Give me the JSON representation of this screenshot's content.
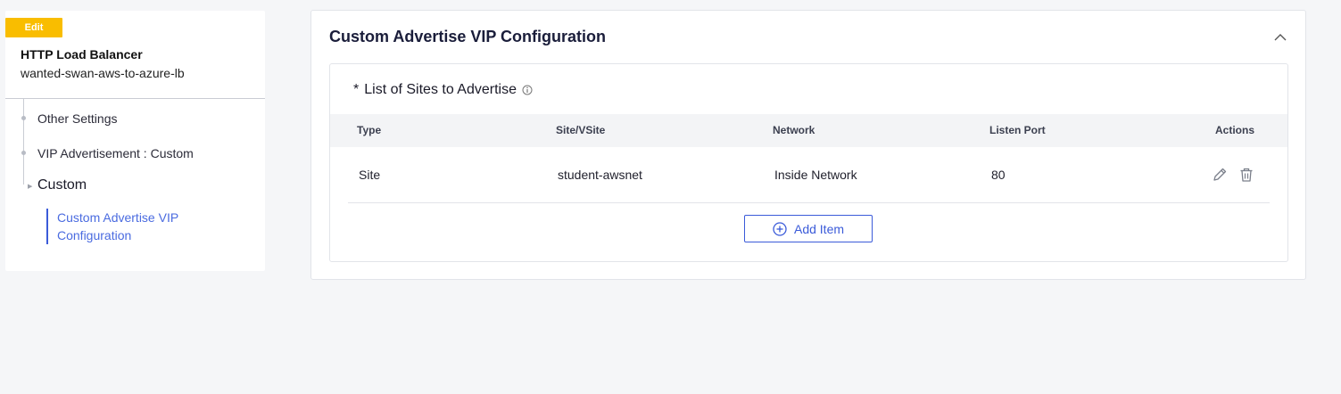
{
  "sidebar": {
    "edit_label": "Edit",
    "object_type": "HTTP Load Balancer",
    "object_name": "wanted-swan-aws-to-azure-lb",
    "tree": {
      "other_settings": "Other Settings",
      "vip_advertisement": "VIP Advertisement : Custom",
      "custom": "Custom",
      "active_item": "Custom Advertise VIP Configuration"
    }
  },
  "panel": {
    "title": "Custom Advertise VIP Configuration",
    "collapse_icon": "chevron-up-icon",
    "section": {
      "required_marker": "*",
      "title": "List of Sites to Advertise",
      "info_icon": "info-icon"
    },
    "table": {
      "headers": {
        "type": "Type",
        "site": "Site/VSite",
        "network": "Network",
        "port": "Listen Port",
        "actions": "Actions"
      },
      "rows": [
        {
          "type": "Site",
          "site": "student-awsnet",
          "network": "Inside Network",
          "port": "80"
        }
      ]
    },
    "add_button_label": "Add Item"
  },
  "colors": {
    "accent": "#3b5bd9",
    "edit_badge": "#f9bd00",
    "background": "#f5f6f8"
  }
}
